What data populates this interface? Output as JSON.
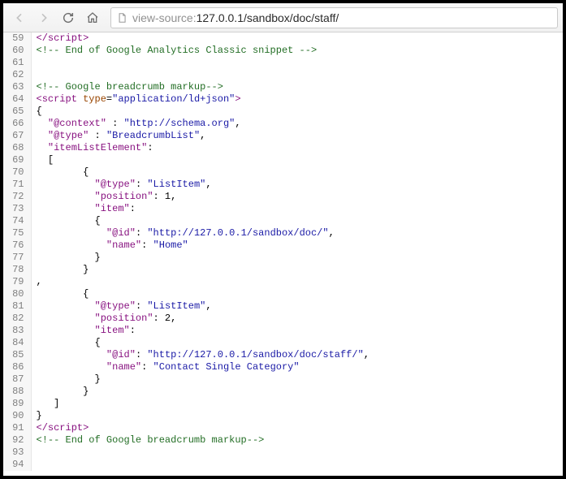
{
  "toolbar": {
    "url_prefix": "view-source:",
    "url_main": "127.0.0.1/sandbox/doc/staff/"
  },
  "lines": [
    {
      "n": 59,
      "t": [
        {
          "c": "m-tag",
          "v": "</script"
        },
        {
          "c": "m-tag",
          "v": ">"
        }
      ]
    },
    {
      "n": 60,
      "t": [
        {
          "c": "m-cmt",
          "v": "<!-- End of Google Analytics Classic snippet -->"
        }
      ]
    },
    {
      "n": 61,
      "t": [
        {
          "c": "",
          "v": ""
        }
      ]
    },
    {
      "n": 62,
      "t": [
        {
          "c": "",
          "v": ""
        }
      ]
    },
    {
      "n": 63,
      "t": [
        {
          "c": "m-cmt",
          "v": "<!-- Google breadcrumb markup-->"
        }
      ]
    },
    {
      "n": 64,
      "t": [
        {
          "c": "m-tag",
          "v": "<script "
        },
        {
          "c": "m-attr",
          "v": "type"
        },
        {
          "c": "",
          "v": "="
        },
        {
          "c": "m-str",
          "v": "\"application/ld+json\""
        },
        {
          "c": "m-tag",
          "v": ">"
        }
      ]
    },
    {
      "n": 65,
      "t": [
        {
          "c": "",
          "v": "{"
        }
      ]
    },
    {
      "n": 66,
      "t": [
        {
          "c": "",
          "v": "  "
        },
        {
          "c": "m-key",
          "v": "\"@context\""
        },
        {
          "c": "",
          "v": " : "
        },
        {
          "c": "m-str",
          "v": "\"http://schema.org\""
        },
        {
          "c": "",
          "v": ","
        }
      ]
    },
    {
      "n": 67,
      "t": [
        {
          "c": "",
          "v": "  "
        },
        {
          "c": "m-key",
          "v": "\"@type\""
        },
        {
          "c": "",
          "v": " : "
        },
        {
          "c": "m-str",
          "v": "\"BreadcrumbList\""
        },
        {
          "c": "",
          "v": ","
        }
      ]
    },
    {
      "n": 68,
      "t": [
        {
          "c": "",
          "v": "  "
        },
        {
          "c": "m-key",
          "v": "\"itemListElement\""
        },
        {
          "c": "",
          "v": ":"
        }
      ]
    },
    {
      "n": 69,
      "t": [
        {
          "c": "",
          "v": "  ["
        }
      ]
    },
    {
      "n": 70,
      "t": [
        {
          "c": "",
          "v": "        {"
        }
      ]
    },
    {
      "n": 71,
      "t": [
        {
          "c": "",
          "v": "          "
        },
        {
          "c": "m-key",
          "v": "\"@type\""
        },
        {
          "c": "",
          "v": ": "
        },
        {
          "c": "m-str",
          "v": "\"ListItem\""
        },
        {
          "c": "",
          "v": ","
        }
      ]
    },
    {
      "n": 72,
      "t": [
        {
          "c": "",
          "v": "          "
        },
        {
          "c": "m-key",
          "v": "\"position\""
        },
        {
          "c": "",
          "v": ": 1,"
        }
      ]
    },
    {
      "n": 73,
      "t": [
        {
          "c": "",
          "v": "          "
        },
        {
          "c": "m-key",
          "v": "\"item\""
        },
        {
          "c": "",
          "v": ":"
        }
      ]
    },
    {
      "n": 74,
      "t": [
        {
          "c": "",
          "v": "          {"
        }
      ]
    },
    {
      "n": 75,
      "t": [
        {
          "c": "",
          "v": "            "
        },
        {
          "c": "m-key",
          "v": "\"@id\""
        },
        {
          "c": "",
          "v": ": "
        },
        {
          "c": "m-str",
          "v": "\"http://127.0.0.1/sandbox/doc/\""
        },
        {
          "c": "",
          "v": ","
        }
      ]
    },
    {
      "n": 76,
      "t": [
        {
          "c": "",
          "v": "            "
        },
        {
          "c": "m-key",
          "v": "\"name\""
        },
        {
          "c": "",
          "v": ": "
        },
        {
          "c": "m-str",
          "v": "\"Home\""
        }
      ]
    },
    {
      "n": 77,
      "t": [
        {
          "c": "",
          "v": "          }"
        }
      ]
    },
    {
      "n": 78,
      "t": [
        {
          "c": "",
          "v": "        }"
        }
      ]
    },
    {
      "n": 79,
      "t": [
        {
          "c": "",
          "v": ","
        }
      ]
    },
    {
      "n": 80,
      "t": [
        {
          "c": "",
          "v": "        {"
        }
      ]
    },
    {
      "n": 81,
      "t": [
        {
          "c": "",
          "v": "          "
        },
        {
          "c": "m-key",
          "v": "\"@type\""
        },
        {
          "c": "",
          "v": ": "
        },
        {
          "c": "m-str",
          "v": "\"ListItem\""
        },
        {
          "c": "",
          "v": ","
        }
      ]
    },
    {
      "n": 82,
      "t": [
        {
          "c": "",
          "v": "          "
        },
        {
          "c": "m-key",
          "v": "\"position\""
        },
        {
          "c": "",
          "v": ": 2,"
        }
      ]
    },
    {
      "n": 83,
      "t": [
        {
          "c": "",
          "v": "          "
        },
        {
          "c": "m-key",
          "v": "\"item\""
        },
        {
          "c": "",
          "v": ":"
        }
      ]
    },
    {
      "n": 84,
      "t": [
        {
          "c": "",
          "v": "          {"
        }
      ]
    },
    {
      "n": 85,
      "t": [
        {
          "c": "",
          "v": "            "
        },
        {
          "c": "m-key",
          "v": "\"@id\""
        },
        {
          "c": "",
          "v": ": "
        },
        {
          "c": "m-str",
          "v": "\"http://127.0.0.1/sandbox/doc/staff/\""
        },
        {
          "c": "",
          "v": ","
        }
      ]
    },
    {
      "n": 86,
      "t": [
        {
          "c": "",
          "v": "            "
        },
        {
          "c": "m-key",
          "v": "\"name\""
        },
        {
          "c": "",
          "v": ": "
        },
        {
          "c": "m-str",
          "v": "\"Contact Single Category\""
        }
      ]
    },
    {
      "n": 87,
      "t": [
        {
          "c": "",
          "v": "          }"
        }
      ]
    },
    {
      "n": 88,
      "t": [
        {
          "c": "",
          "v": "        }"
        }
      ]
    },
    {
      "n": 89,
      "t": [
        {
          "c": "",
          "v": "   ]"
        }
      ]
    },
    {
      "n": 90,
      "t": [
        {
          "c": "",
          "v": "}"
        }
      ]
    },
    {
      "n": 91,
      "t": [
        {
          "c": "m-tag",
          "v": "</script"
        },
        {
          "c": "m-tag",
          "v": ">"
        }
      ]
    },
    {
      "n": 92,
      "t": [
        {
          "c": "m-cmt",
          "v": "<!-- End of Google breadcrumb markup-->"
        }
      ]
    },
    {
      "n": 93,
      "t": [
        {
          "c": "",
          "v": ""
        }
      ]
    },
    {
      "n": 94,
      "t": [
        {
          "c": "",
          "v": ""
        }
      ]
    }
  ]
}
